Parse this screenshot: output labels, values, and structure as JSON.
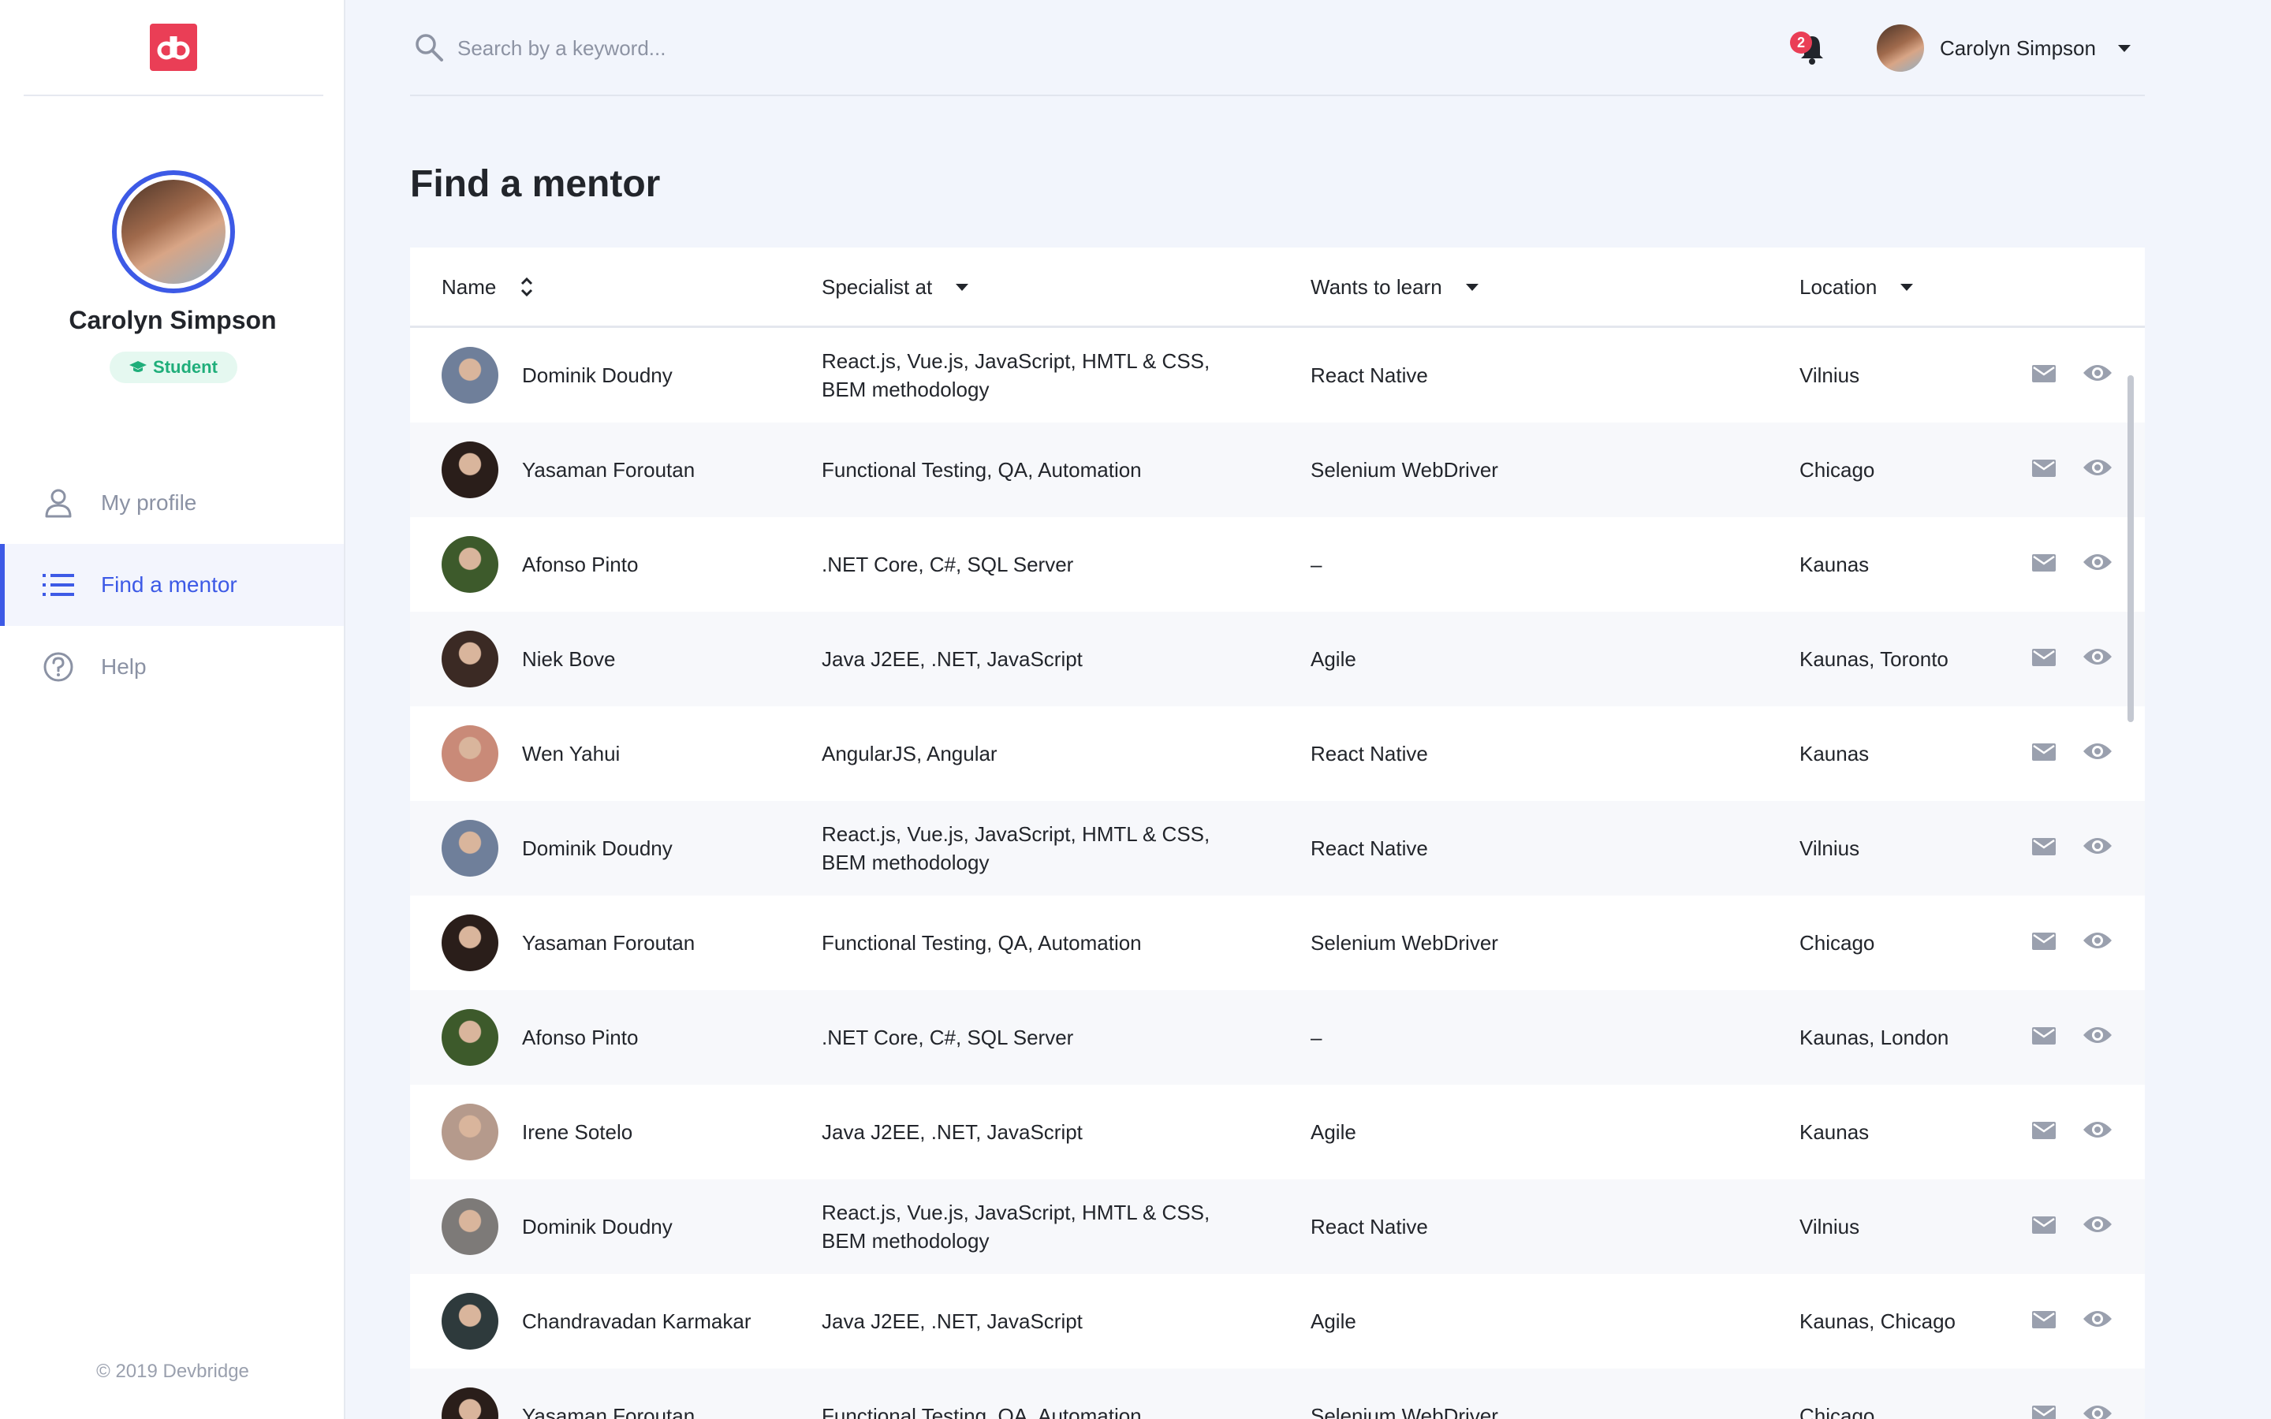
{
  "brand": {
    "logo_text": "db"
  },
  "sidebar": {
    "profile": {
      "name": "Carolyn Simpson",
      "role": "Student"
    },
    "nav": [
      {
        "label": "My profile",
        "icon": "user-icon",
        "active": false
      },
      {
        "label": "Find a mentor",
        "icon": "list-icon",
        "active": true
      },
      {
        "label": "Help",
        "icon": "help-icon",
        "active": false
      }
    ],
    "copyright": "© 2019 Devbridge"
  },
  "header": {
    "search": {
      "placeholder": "Search by a keyword...",
      "value": ""
    },
    "notifications": {
      "count": "2"
    },
    "user": {
      "name": "Carolyn Simpson"
    }
  },
  "page": {
    "title": "Find a mentor"
  },
  "table": {
    "columns": {
      "name": "Name",
      "specialist": "Specialist at",
      "learn": "Wants to learn",
      "location": "Location"
    },
    "rows": [
      {
        "name": "Dominik Doudny",
        "specialist": "React.js, Vue.js, JavaScript, HMTL & CSS, BEM methodology",
        "learn": "React Native",
        "location": "Vilnius",
        "avatar_color": "#6f7f9a"
      },
      {
        "name": "Yasaman Foroutan",
        "specialist": "Functional Testing, QA, Automation",
        "learn": "Selenium WebDriver",
        "location": "Chicago",
        "avatar_color": "#2a1e1a"
      },
      {
        "name": "Afonso Pinto",
        "specialist": ".NET Core, C#, SQL Server",
        "learn": "–",
        "location": "Kaunas",
        "avatar_color": "#3d5a2b"
      },
      {
        "name": "Niek Bove",
        "specialist": "Java J2EE, .NET, JavaScript",
        "learn": "Agile",
        "location": "Kaunas, Toronto",
        "avatar_color": "#3b2a24"
      },
      {
        "name": "Wen Yahui",
        "specialist": "AngularJS, Angular",
        "learn": "React Native",
        "location": "Kaunas",
        "avatar_color": "#c98a78"
      },
      {
        "name": "Dominik Doudny",
        "specialist": "React.js, Vue.js, JavaScript, HMTL & CSS, BEM methodology",
        "learn": "React Native",
        "location": "Vilnius",
        "avatar_color": "#6f7f9a"
      },
      {
        "name": "Yasaman Foroutan",
        "specialist": "Functional Testing, QA, Automation",
        "learn": "Selenium WebDriver",
        "location": "Chicago",
        "avatar_color": "#2a1e1a"
      },
      {
        "name": "Afonso Pinto",
        "specialist": ".NET Core, C#, SQL Server",
        "learn": "–",
        "location": "Kaunas, London",
        "avatar_color": "#3d5a2b"
      },
      {
        "name": "Irene Sotelo",
        "specialist": "Java J2EE, .NET, JavaScript",
        "learn": "Agile",
        "location": "Kaunas",
        "avatar_color": "#b59a8c"
      },
      {
        "name": "Dominik Doudny",
        "specialist": "React.js, Vue.js, JavaScript, HMTL & CSS, BEM methodology",
        "learn": "React Native",
        "location": "Vilnius",
        "avatar_color": "#7d7a78"
      },
      {
        "name": "Chandravadan Karmakar",
        "specialist": "Java J2EE, .NET, JavaScript",
        "learn": "Agile",
        "location": "Kaunas, Chicago",
        "avatar_color": "#2e3a3c"
      },
      {
        "name": "Yasaman Foroutan",
        "specialist": "Functional Testing, QA, Automation",
        "learn": "Selenium WebDriver",
        "location": "Chicago",
        "avatar_color": "#2a1e1a"
      }
    ]
  },
  "colors": {
    "accent": "#3d5ae6",
    "brand": "#ea3e56",
    "success": "#1fae7a",
    "background": "#f2f5fc",
    "icon_muted": "#8b92a4"
  }
}
